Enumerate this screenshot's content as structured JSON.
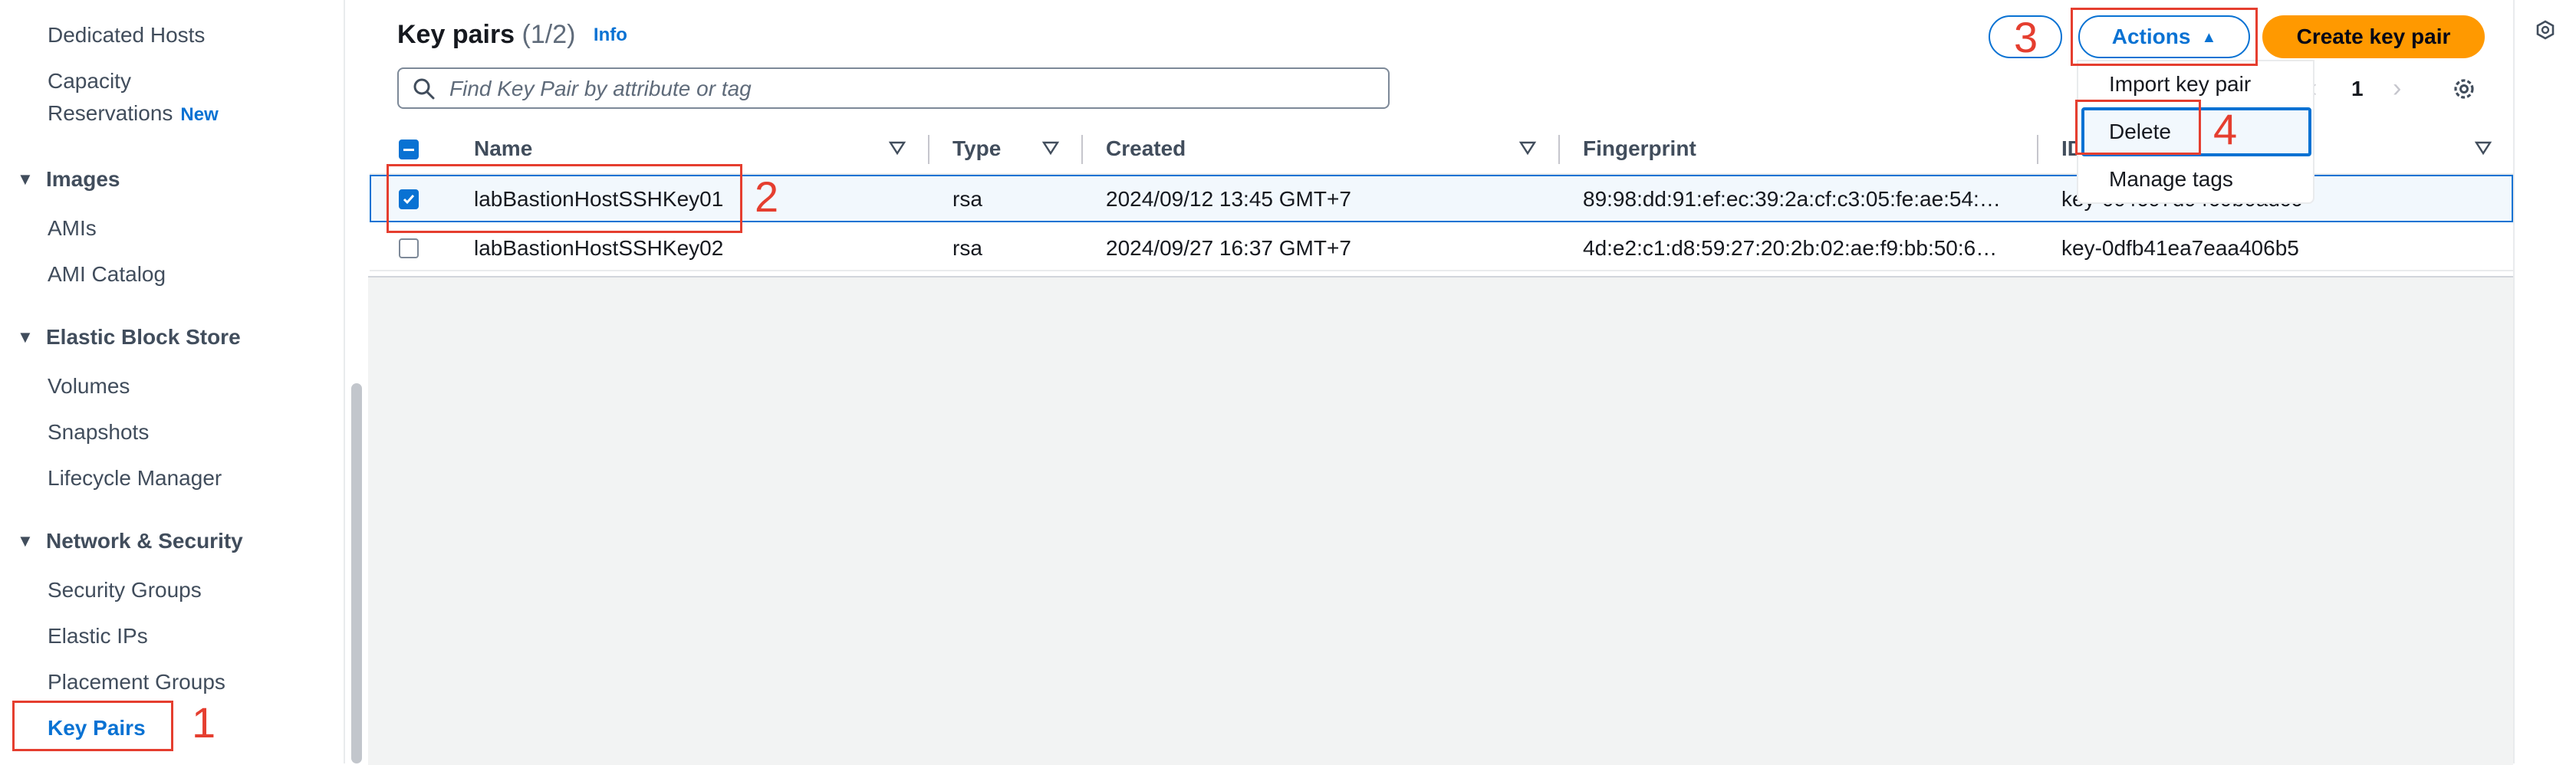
{
  "sidebar": {
    "items_top": [
      "Dedicated Hosts",
      "Capacity",
      "Reservations"
    ],
    "new_badge": "New",
    "images_section": "Images",
    "images_items": [
      "AMIs",
      "AMI Catalog"
    ],
    "ebs_section": "Elastic Block Store",
    "ebs_items": [
      "Volumes",
      "Snapshots",
      "Lifecycle Manager"
    ],
    "network_section": "Network & Security",
    "network_items": [
      "Security Groups",
      "Elastic IPs",
      "Placement Groups",
      "Key Pairs"
    ]
  },
  "header": {
    "title": "Key pairs",
    "count": "(1/2)",
    "info_link": "Info"
  },
  "search": {
    "placeholder": "Find Key Pair by attribute or tag"
  },
  "toolbar": {
    "actions_label": "Actions",
    "create_label": "Create key pair"
  },
  "actions_menu": {
    "items": [
      "Import key pair",
      "Delete",
      "Manage tags"
    ]
  },
  "pagination": {
    "current_page": "1"
  },
  "table": {
    "columns": [
      "Name",
      "Type",
      "Created",
      "Fingerprint",
      "ID"
    ],
    "rows": [
      {
        "selected": true,
        "name": "labBastionHostSSHKey01",
        "type": "rsa",
        "created": "2024/09/12 13:45 GMT+7",
        "fingerprint": "89:98:dd:91:ef:ec:39:2a:cf:c3:05:fe:ae:54:…",
        "id": "key-0c4697d9469b0adc6"
      },
      {
        "selected": false,
        "name": "labBastionHostSSHKey02",
        "type": "rsa",
        "created": "2024/09/27 16:37 GMT+7",
        "fingerprint": "4d:e2:c1:d8:59:27:20:2b:02:ae:f9:bb:50:6…",
        "id": "key-0dfb41ea7eaa406b5"
      }
    ]
  },
  "annotations": {
    "step1": "1",
    "step2": "2",
    "step3": "3",
    "step4": "4"
  },
  "colors": {
    "link_blue": "#0972d3",
    "primary_orange": "#ff9900",
    "annotation_red": "#e53e2f"
  }
}
